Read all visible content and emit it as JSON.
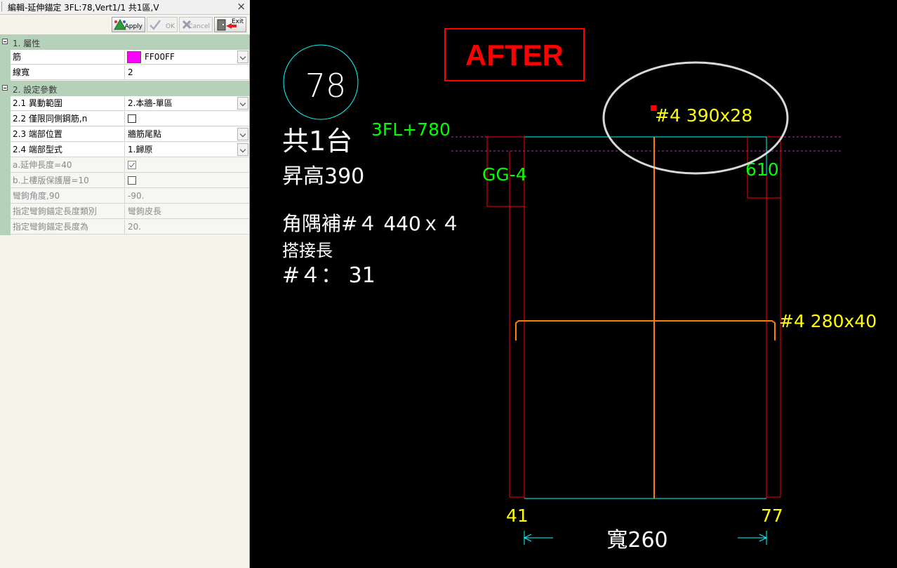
{
  "panel": {
    "title": "編輯-延伸錨定 3FL:78,Vert1/1 共1區,V",
    "close": "×",
    "toolbar": {
      "apply": "Apply",
      "ok": "OK",
      "cancel": "Cancel",
      "exit": "Exit"
    },
    "categories": [
      "1. 屬性",
      "2. 設定參數"
    ],
    "props": [
      {
        "name": "筋",
        "value": "FF00FF"
      },
      {
        "name": "線寬",
        "value": "2"
      },
      {
        "name": "2.1 異動範圍",
        "value": "2.本牆-單區"
      },
      {
        "name": "2.2 僅限同側鋼筋,n",
        "value": ""
      },
      {
        "name": "2.3 端部位置",
        "value": "牆筋尾點"
      },
      {
        "name": "2.4 端部型式",
        "value": "1.歸原"
      },
      {
        "name": "a.延伸長度=40",
        "value": ""
      },
      {
        "name": "b.上樓版保護層=10",
        "value": ""
      },
      {
        "name": "彎鉤角度,90",
        "value": "-90."
      },
      {
        "name": "指定彎鉤錨定長度類別",
        "value": "彎鉤皮長"
      },
      {
        "name": "指定彎鉤錨定長度為",
        "value": "20."
      }
    ],
    "colors": {
      "swatch": "#ff00ff",
      "category": "#b5d1b9"
    }
  },
  "cad": {
    "after_label": "AFTER",
    "circle_number": "78",
    "count_label": "共1台",
    "rise_label": "昇高390",
    "corner_label": "角隅補#４ 440ｘ４",
    "lap_title": "搭接長",
    "lap_value": "#４： 31",
    "floor_label": "3FL+780",
    "beam_label": "GG-4",
    "beam_right_label": "610",
    "top_bar_label": "#4 390x28",
    "stirrup_label": "#4 280x40",
    "left_dim": "41",
    "right_dim": "77",
    "width_label": "寬260",
    "colors": {
      "red": "#ff0000",
      "cyan": "#00ffff",
      "yellow": "#ffff00",
      "green": "#00ff00",
      "white": "#ffffff",
      "orange": "#ff8000",
      "magenta": "#ff00ff"
    }
  }
}
